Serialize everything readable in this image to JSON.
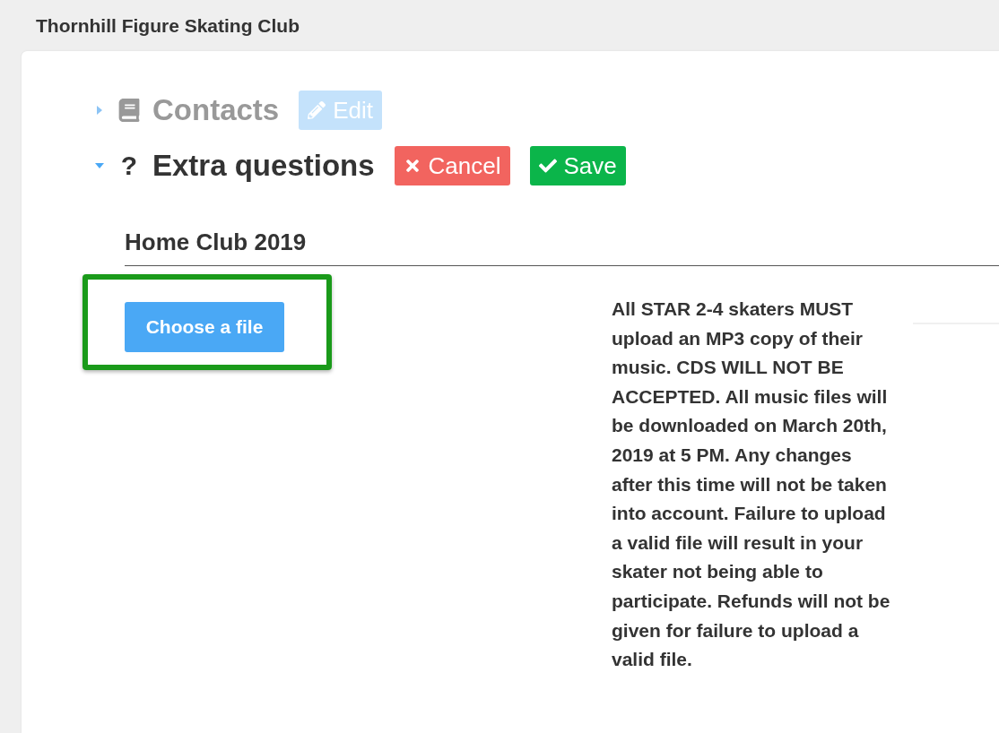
{
  "header": {
    "title": "Thornhill Figure Skating Club"
  },
  "sections": [
    {
      "title": "Contacts",
      "expanded": false,
      "disabled": true,
      "buttons": [
        {
          "kind": "edit",
          "label": "Edit",
          "disabled": true
        }
      ]
    },
    {
      "title": "Extra questions",
      "expanded": true,
      "disabled": false,
      "icon_text": "?",
      "buttons": [
        {
          "kind": "cancel",
          "label": "Cancel",
          "disabled": false
        },
        {
          "kind": "save",
          "label": "Save",
          "disabled": false
        }
      ]
    }
  ],
  "question": {
    "title": "Home Club 2019",
    "upload_button": {
      "label": "Choose a file",
      "highlighted": true
    },
    "note": "All STAR 2-4 skaters MUST upload an MP3 copy of their music. CDS WILL NOT BE ACCEPTED. All music files will be downloaded on March 20th, 2019 at 5 PM. Any changes after this time will not be taken into account. Failure to upload a valid file will result in your skater not being able to participate. Refunds will not be given for failure to upload a valid file."
  }
}
